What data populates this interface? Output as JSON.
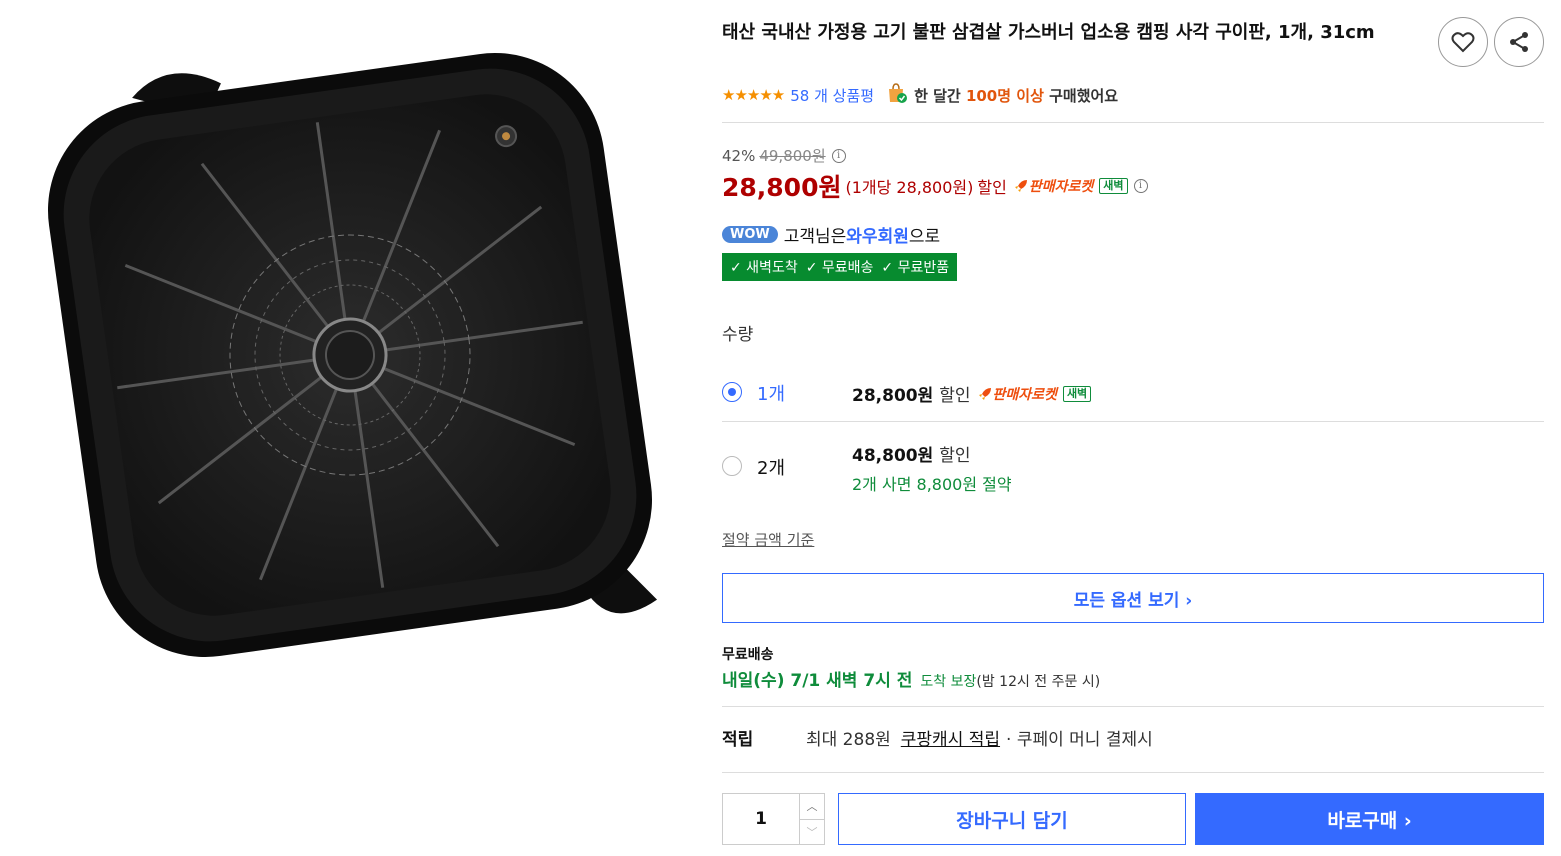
{
  "product": {
    "title": "태산 국내산 가정용 고기 불판 삼겹살 가스버너 업소용 캠핑 사각 구이판, 1개, 31cm",
    "stars": "★★★★★",
    "review_count": "58 개 상품평",
    "bought_prefix": "한 달간 ",
    "bought_highlight": "100명 이상",
    "bought_suffix": " 구매했어요"
  },
  "price": {
    "discount_rate": "42%",
    "original": "49,800원",
    "sale": "28,800원",
    "per_unit": "(1개당 28,800원)",
    "discount_word": "할인",
    "rocket_label": "판매자로켓",
    "dawn_badge": "새벽"
  },
  "membership": {
    "wow": "WOW",
    "prefix": "고객님은 ",
    "name": "와우회원",
    "suffix": "으로"
  },
  "benefits": [
    "✓ 새벽도착",
    "✓ 무료배송",
    "✓ 무료반품"
  ],
  "quantity": {
    "label": "수량",
    "options": [
      {
        "name": "1개",
        "price": "28,800원",
        "discount": "할인",
        "rocket": "판매자로켓",
        "badge": "새벽",
        "selected": true
      },
      {
        "name": "2개",
        "price": "48,800원",
        "discount": "할인",
        "saving": "2개 사면 8,800원 절약",
        "selected": false
      }
    ],
    "saving_basis_link": "절약 금액 기준"
  },
  "all_options_label": "모든 옵션 보기 ›",
  "shipping": {
    "label": "무료배송",
    "date": "내일(수) 7/1 새벽 7시 전",
    "guarantee": "도착 보장",
    "condition": "(밤 12시 전 주문 시)"
  },
  "points": {
    "label": "적립",
    "prefix": "최대 288원",
    "cash_link": "쿠팡캐시 적립",
    "suffix": "· 쿠페이 머니 결제시"
  },
  "purchase": {
    "quantity_value": "1",
    "cart_label": "장바구니 담기",
    "buy_label": "바로구매 ›"
  },
  "colors": {
    "accent_blue": "#346aff",
    "price_red": "#ae0000",
    "green": "#0f8c3b",
    "rocket_orange": "#ee4e0e"
  },
  "icons": [
    "heart-icon",
    "share-icon",
    "shopping-bag-icon",
    "info-icon",
    "rocket-icon",
    "check-icon",
    "chevron-right-icon",
    "chevron-up-icon",
    "chevron-down-icon"
  ]
}
